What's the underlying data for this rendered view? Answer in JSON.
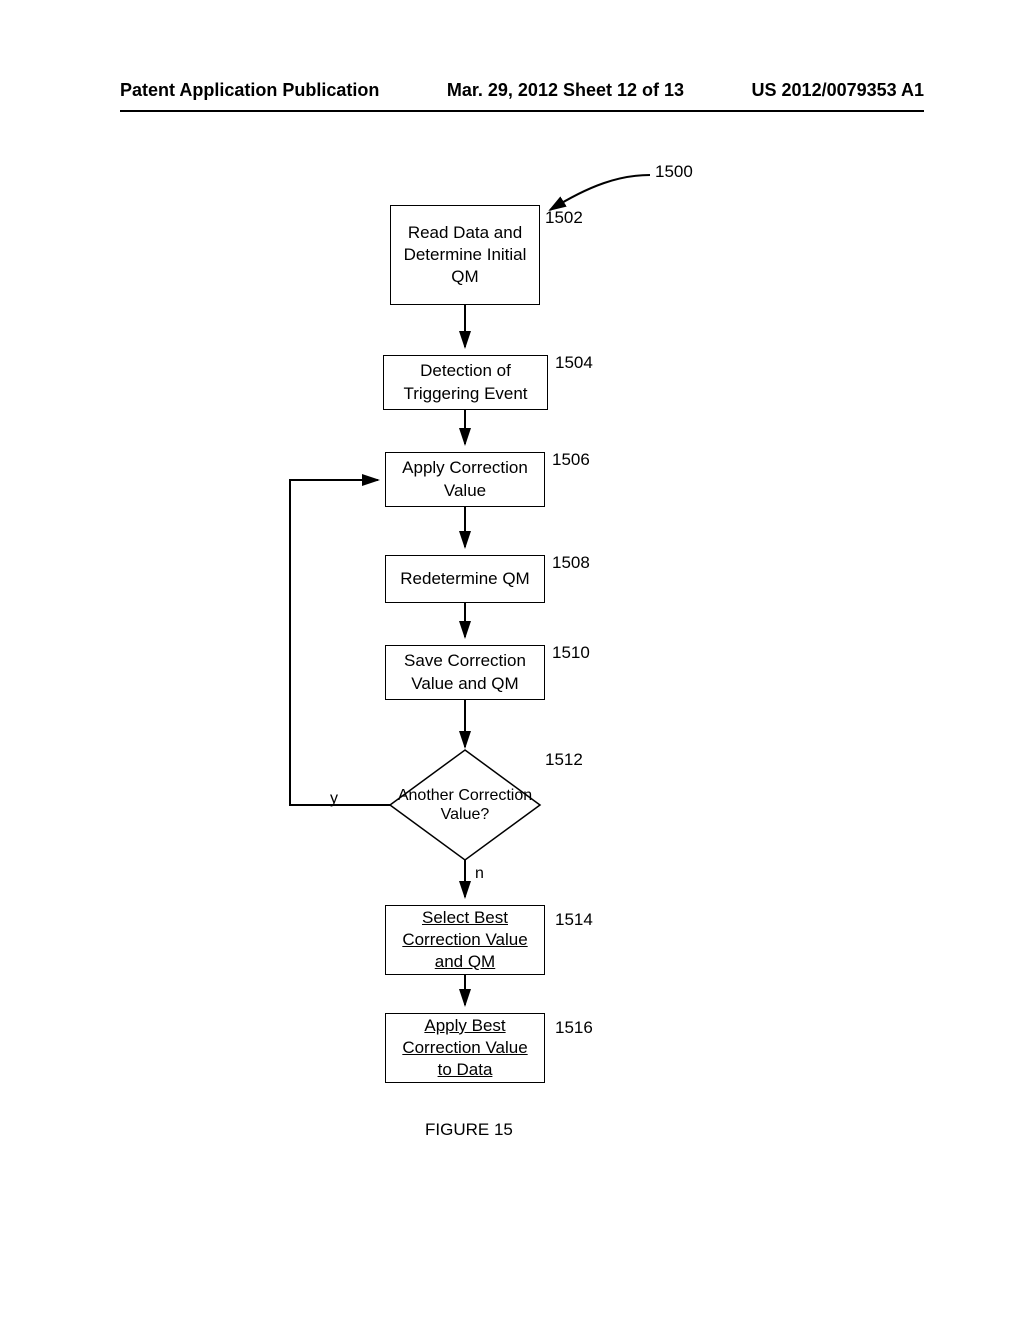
{
  "header": {
    "left": "Patent Application Publication",
    "center": "Mar. 29, 2012  Sheet 12 of 13",
    "right": "US 2012/0079353 A1"
  },
  "figure_label": "FIGURE 15",
  "flow": {
    "overall_ref": "1500",
    "steps": {
      "s1502": {
        "text": "Read Data and Determine Initial QM",
        "ref": "1502"
      },
      "s1504": {
        "text": "Detection of Triggering Event",
        "ref": "1504"
      },
      "s1506": {
        "text": "Apply Correction Value",
        "ref": "1506"
      },
      "s1508": {
        "text": "Redetermine QM",
        "ref": "1508"
      },
      "s1510": {
        "text": "Save Correction Value and QM",
        "ref": "1510"
      },
      "s1512": {
        "text": "Another Correction Value?",
        "ref": "1512",
        "yes": "y",
        "no": "n"
      },
      "s1514": {
        "text": "Select Best Correction Value and QM",
        "ref": "1514"
      },
      "s1516": {
        "text": "Apply Best Correction Value to Data",
        "ref": "1516"
      }
    }
  },
  "chart_data": {
    "type": "flowchart",
    "title": "FIGURE 15",
    "overall_ref": "1500",
    "nodes": [
      {
        "id": "1502",
        "type": "process",
        "label": "Read Data and Determine Initial QM"
      },
      {
        "id": "1504",
        "type": "process",
        "label": "Detection of Triggering Event"
      },
      {
        "id": "1506",
        "type": "process",
        "label": "Apply Correction Value"
      },
      {
        "id": "1508",
        "type": "process",
        "label": "Redetermine QM"
      },
      {
        "id": "1510",
        "type": "process",
        "label": "Save Correction Value and QM"
      },
      {
        "id": "1512",
        "type": "decision",
        "label": "Another Correction Value?"
      },
      {
        "id": "1514",
        "type": "process",
        "label": "Select Best Correction Value and QM"
      },
      {
        "id": "1516",
        "type": "process",
        "label": "Apply Best Correction Value to Data"
      }
    ],
    "edges": [
      {
        "from": "start",
        "to": "1502"
      },
      {
        "from": "1502",
        "to": "1504"
      },
      {
        "from": "1504",
        "to": "1506"
      },
      {
        "from": "1506",
        "to": "1508"
      },
      {
        "from": "1508",
        "to": "1510"
      },
      {
        "from": "1510",
        "to": "1512"
      },
      {
        "from": "1512",
        "to": "1506",
        "label": "y"
      },
      {
        "from": "1512",
        "to": "1514",
        "label": "n"
      },
      {
        "from": "1514",
        "to": "1516"
      }
    ]
  }
}
